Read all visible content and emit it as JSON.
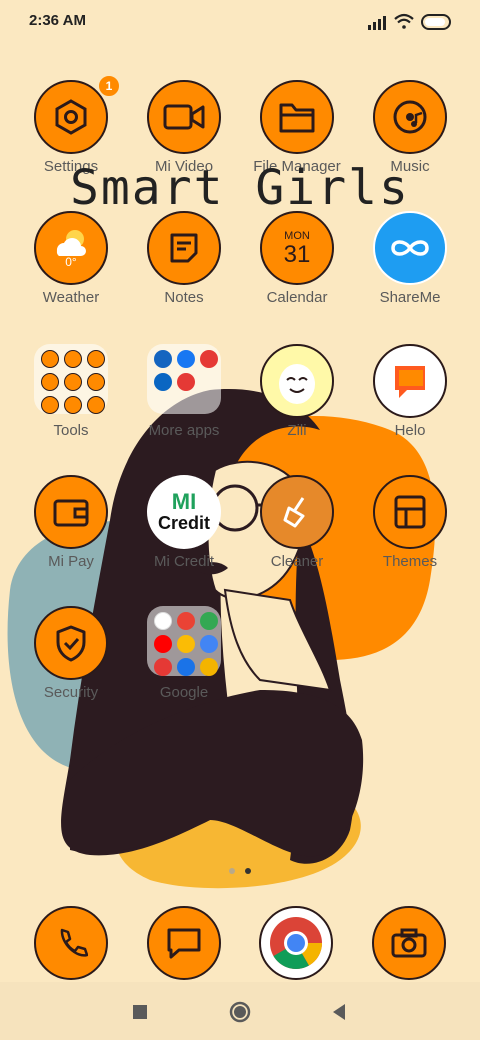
{
  "status": {
    "time": "2:36 AM"
  },
  "banner": "Smart Girls",
  "apps": {
    "settings": {
      "label": "Settings",
      "badge": "1",
      "icon": "settings-hexagon-icon"
    },
    "mi_video": {
      "label": "Mi Video",
      "icon": "video-camera-icon"
    },
    "file_manager": {
      "label": "File Manager",
      "icon": "folder-icon"
    },
    "music": {
      "label": "Music",
      "icon": "music-disc-icon"
    },
    "weather": {
      "label": "Weather",
      "temp": "0°",
      "icon": "weather-sun-cloud-icon"
    },
    "notes": {
      "label": "Notes",
      "icon": "notes-icon"
    },
    "calendar": {
      "label": "Calendar",
      "month": "MON",
      "day": "31",
      "icon": "calendar-icon"
    },
    "shareme": {
      "label": "ShareMe",
      "icon": "infinity-share-icon"
    },
    "tools": {
      "label": "Tools",
      "icon": "tools-folder-icon"
    },
    "more_apps": {
      "label": "More apps",
      "icon": "more-apps-folder-icon"
    },
    "zili": {
      "label": "Zili",
      "icon": "zili-face-icon"
    },
    "helo": {
      "label": "Helo",
      "icon": "helo-chat-icon"
    },
    "mi_pay": {
      "label": "Mi Pay",
      "icon": "wallet-icon"
    },
    "mi_credit": {
      "label": "Mi Credit",
      "logo_top": "MI",
      "logo_bottom": "Credit",
      "icon": "mi-credit-logo-icon"
    },
    "cleaner": {
      "label": "Cleaner",
      "icon": "broom-icon"
    },
    "themes": {
      "label": "Themes",
      "icon": "themes-icon"
    },
    "security": {
      "label": "Security",
      "icon": "shield-check-icon"
    },
    "google": {
      "label": "Google",
      "icon": "google-folder-icon"
    }
  },
  "dock": {
    "phone": {
      "icon": "phone-icon"
    },
    "messages": {
      "icon": "message-icon"
    },
    "chrome": {
      "icon": "chrome-icon"
    },
    "camera": {
      "icon": "camera-icon"
    }
  },
  "nav": {
    "recents": "recents-icon",
    "home": "home-icon",
    "back": "back-icon"
  },
  "colors": {
    "background": "#fbe8c1",
    "accent_orange": "#ff8a00",
    "outline": "#2b1a1a",
    "label_gray": "#5a5a5a",
    "hair": "#2c1b20",
    "teal_blob": "#8fb2b5",
    "yellow_blob": "#f7b733"
  }
}
